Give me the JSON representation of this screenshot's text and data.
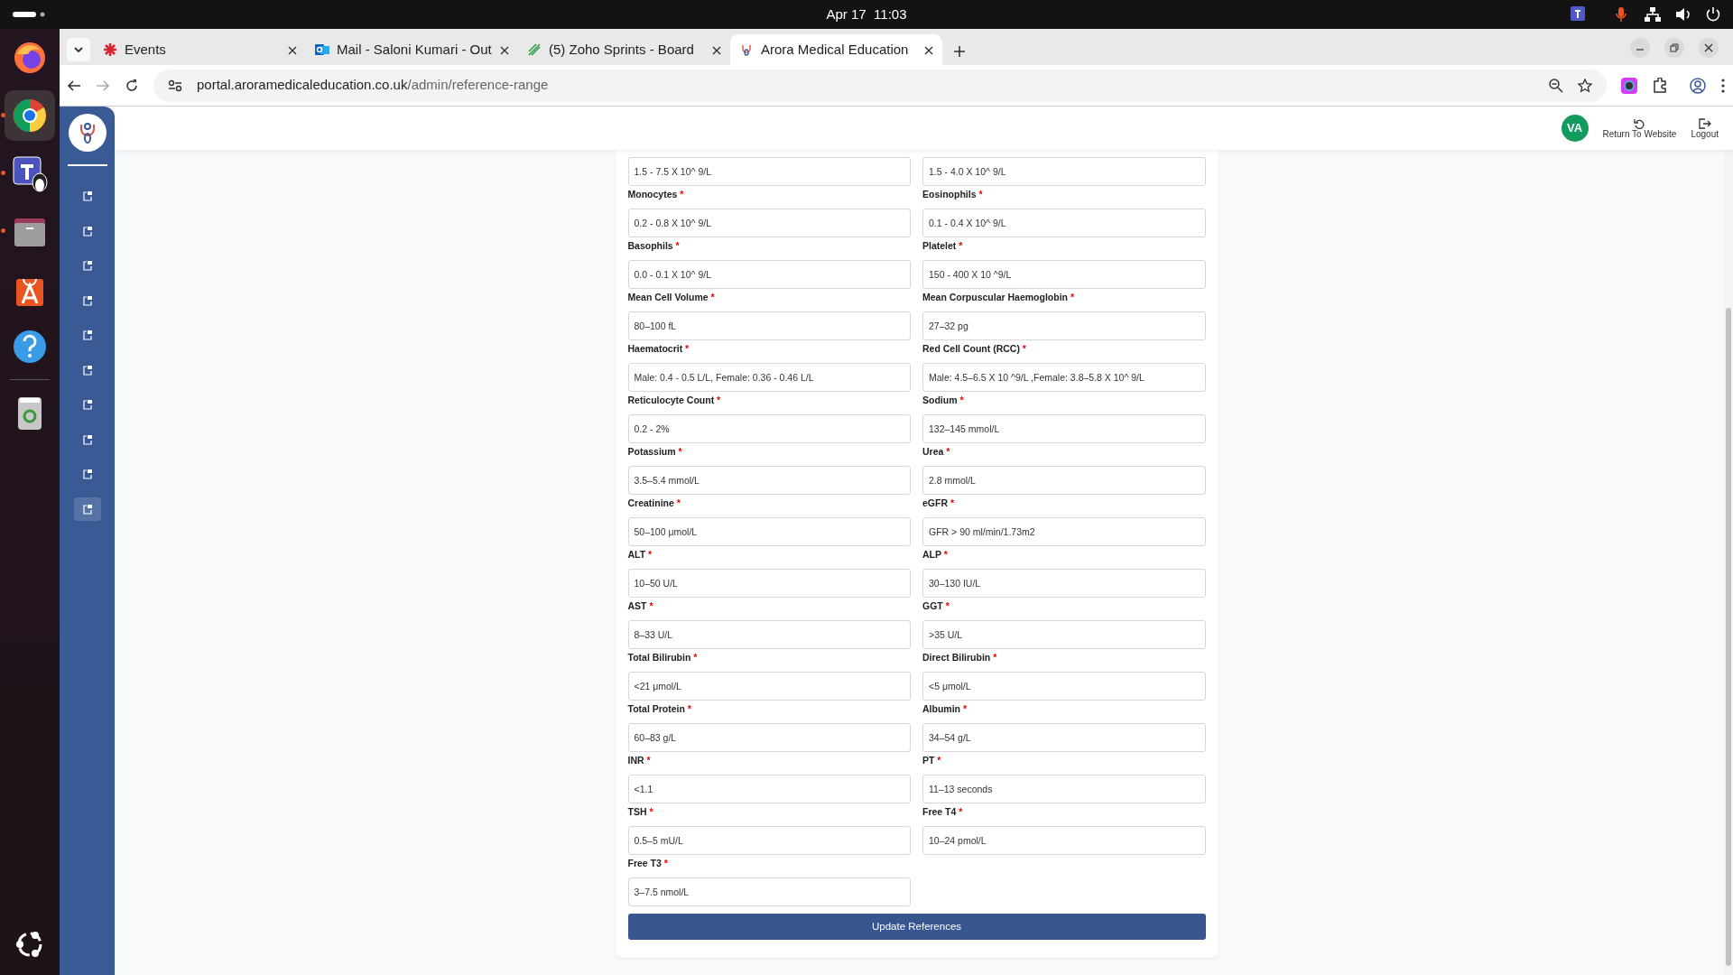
{
  "top_bar": {
    "date": "Apr 17",
    "time": "11:03"
  },
  "dock": [
    {
      "kind": "firefox",
      "running": false,
      "selected": false
    },
    {
      "kind": "chrome",
      "running": true,
      "selected": true
    },
    {
      "kind": "teams",
      "running": true,
      "selected": false
    },
    {
      "kind": "files",
      "running": true,
      "selected": false
    },
    {
      "kind": "store",
      "running": false,
      "selected": false
    },
    {
      "kind": "help",
      "running": false,
      "selected": false
    },
    {
      "kind": "trash",
      "running": false,
      "selected": false
    }
  ],
  "tabs": [
    {
      "kind": "events",
      "title": "Events",
      "selected": false
    },
    {
      "kind": "mail",
      "title": "Mail - Saloni Kumari - Out",
      "selected": false
    },
    {
      "kind": "sprints",
      "title": "(5) Zoho Sprints - Board",
      "selected": false
    },
    {
      "kind": "site",
      "title": "Arora Medical Education",
      "selected": true
    }
  ],
  "address": {
    "host": "portal.aroramedicaleducation.co.uk",
    "path": "/admin/reference-range"
  },
  "sidebar": {
    "items": [
      {
        "selected": false
      },
      {
        "selected": false
      },
      {
        "selected": false
      },
      {
        "selected": false
      },
      {
        "selected": false
      },
      {
        "selected": false
      },
      {
        "selected": false
      },
      {
        "selected": false
      },
      {
        "selected": false
      },
      {
        "selected": true
      }
    ]
  },
  "header": {
    "avatar": "VA",
    "return_link": "Return To Website",
    "logout": "Logout"
  },
  "fields": [
    {
      "value": "1.5 - 7.5 X 10^ 9/L"
    },
    {
      "value": "1.5 - 4.0 X 10^ 9/L"
    },
    {
      "label": "Monocytes",
      "required": true,
      "value": "0.2 - 0.8 X 10^ 9/L"
    },
    {
      "label": "Eosinophils",
      "required": true,
      "value": "0.1 - 0.4 X 10^ 9/L"
    },
    {
      "label": "Basophils",
      "required": true,
      "value": "0.0 - 0.1 X 10^ 9/L"
    },
    {
      "label": "Platelet",
      "required": true,
      "value": "150 - 400 X 10 ^9/L"
    },
    {
      "label": "Mean Cell Volume",
      "required": true,
      "value": "80–100 fL"
    },
    {
      "label": "Mean Corpuscular Haemoglobin",
      "required": true,
      "value": "27–32 pg"
    },
    {
      "label": "Haematocrit",
      "required": true,
      "value": "Male: 0.4 - 0.5 L/L, Female: 0.36 - 0.46 L/L"
    },
    {
      "label": "Red Cell Count (RCC)",
      "required": true,
      "value": "Male: 4.5–6.5 X 10 ^9/L ,Female: 3.8–5.8 X 10^ 9/L"
    },
    {
      "label": "Reticulocyte Count",
      "required": true,
      "value": "0.2 - 2%"
    },
    {
      "label": "Sodium",
      "required": true,
      "value": "132–145 mmol/L"
    },
    {
      "label": "Potassium",
      "required": true,
      "value": "3.5–5.4 mmol/L"
    },
    {
      "label": "Urea",
      "required": true,
      "value": "2.8 mmol/L"
    },
    {
      "label": "Creatinine",
      "required": true,
      "value": "50–100 μmol/L"
    },
    {
      "label": "eGFR",
      "required": true,
      "value": "GFR > 90 ml/min/1.73m2"
    },
    {
      "label": "ALT",
      "required": true,
      "value": "10–50 U/L"
    },
    {
      "label": "ALP",
      "required": true,
      "value": "30–130 IU/L"
    },
    {
      "label": "AST",
      "required": true,
      "value": "8–33 U/L"
    },
    {
      "label": "GGT",
      "required": true,
      "value": ">35 U/L"
    },
    {
      "label": "Total Bilirubin",
      "required": true,
      "value": "<21 μmol/L"
    },
    {
      "label": "Direct Bilirubin",
      "required": true,
      "value": "<5 μmol/L"
    },
    {
      "label": "Total Protein",
      "required": true,
      "value": "60–83 g/L"
    },
    {
      "label": "Albumin",
      "required": true,
      "value": "34–54 g/L"
    },
    {
      "label": "INR",
      "required": true,
      "value": "<1.1"
    },
    {
      "label": "PT",
      "required": true,
      "value": "11–13 seconds"
    },
    {
      "label": "TSH",
      "required": true,
      "value": "0.5–5 mU/L"
    },
    {
      "label": "Free T4",
      "required": true,
      "value": "10–24 pmol/L"
    },
    {
      "label": "Free T3",
      "required": true,
      "value": "3–7.5 nmol/L"
    }
  ],
  "required_mark": "*",
  "submit": "Update References"
}
